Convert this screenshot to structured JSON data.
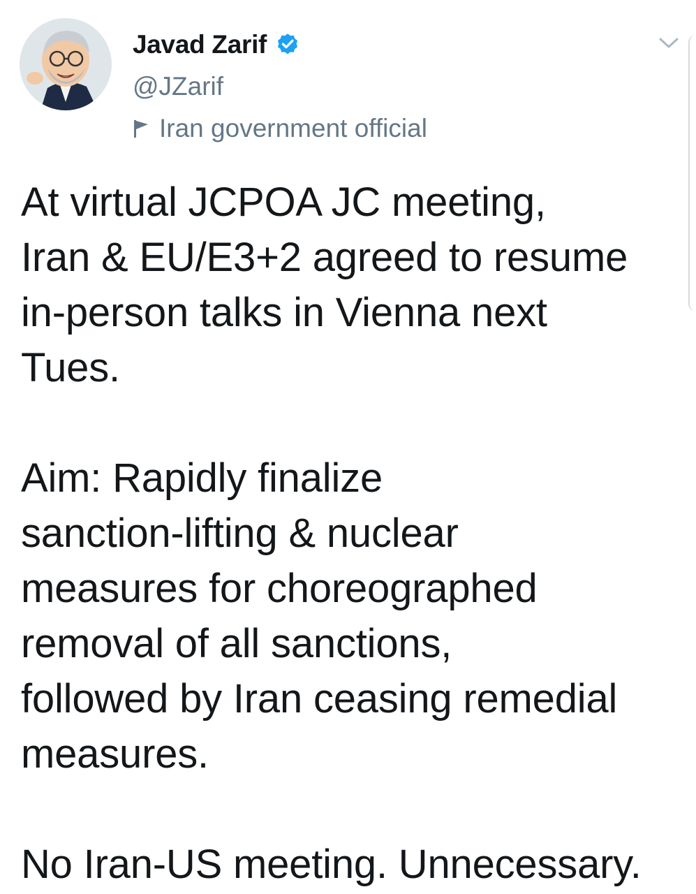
{
  "tweet": {
    "author": {
      "display_name": "Javad Zarif",
      "handle": "@JZarif",
      "label": "Iran government official",
      "verified": true
    },
    "icons": {
      "verified": "verified-badge-icon",
      "label": "flag-icon",
      "menu": "chevron-down-icon",
      "avatar": "caricature-avatar"
    },
    "paragraphs": [
      {
        "lines": [
          "At virtual JCPOA JC meeting,",
          "Iran & EU/E3+2 agreed to resume",
          "in-person talks in Vienna next",
          "Tues."
        ]
      },
      {
        "lines": [
          "Aim: Rapidly finalize",
          "sanction-lifting & nuclear",
          "measures for choreographed",
          "removal of all sanctions,",
          "followed by Iran ceasing remedial",
          "measures."
        ]
      },
      {
        "lines": [
          "No Iran-US meeting. Unnecessary."
        ]
      }
    ],
    "colors": {
      "text": "#14171a",
      "secondary": "#657786",
      "verified": "#1da1f2"
    }
  }
}
